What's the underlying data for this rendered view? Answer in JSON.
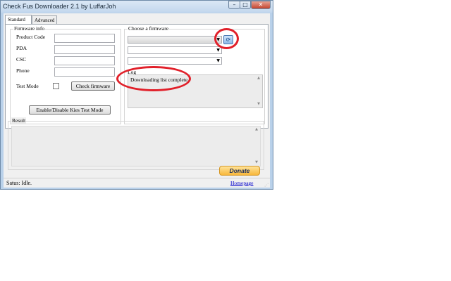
{
  "window": {
    "title": "Check Fus Downloader 2.1 by LuffarJoh",
    "buttons": {
      "minimize": "–",
      "maximize": "□",
      "close": "✕"
    }
  },
  "tabs": [
    {
      "label": "Standard",
      "selected": true
    },
    {
      "label": "Advanced",
      "selected": false
    }
  ],
  "firmware_info": {
    "title": "Firmware info",
    "fields": [
      {
        "label": "Product Code",
        "value": ""
      },
      {
        "label": "PDA",
        "value": ""
      },
      {
        "label": "CSC",
        "value": ""
      },
      {
        "label": "Phone",
        "value": ""
      }
    ],
    "test_mode_label": "Test Mode",
    "test_mode_checked": false,
    "check_button": "Check firmware",
    "kies_button": "Enable/Disable Kies Test Mode"
  },
  "choose_firmware": {
    "title": "Choose a firmware",
    "combos": [
      {
        "value": "",
        "arrow": "▼"
      },
      {
        "value": "",
        "arrow": "▼"
      },
      {
        "value": "",
        "arrow": "▼"
      }
    ],
    "refresh_icon": "⟳"
  },
  "log": {
    "label": "Log",
    "text": "Downloading list complete.",
    "scroll_up": "▲",
    "scroll_down": "▼"
  },
  "result": {
    "label": "Result",
    "scroll_up": "▲",
    "scroll_down": "▼"
  },
  "donate_button": "Donate",
  "statusbar": {
    "status": "Satus: Idle.",
    "homepage_link": "Homepage",
    "grip": "⋰"
  },
  "colors": {
    "annotation": "#e1202a",
    "donate": "#f8b73a",
    "link": "#0000cc"
  }
}
